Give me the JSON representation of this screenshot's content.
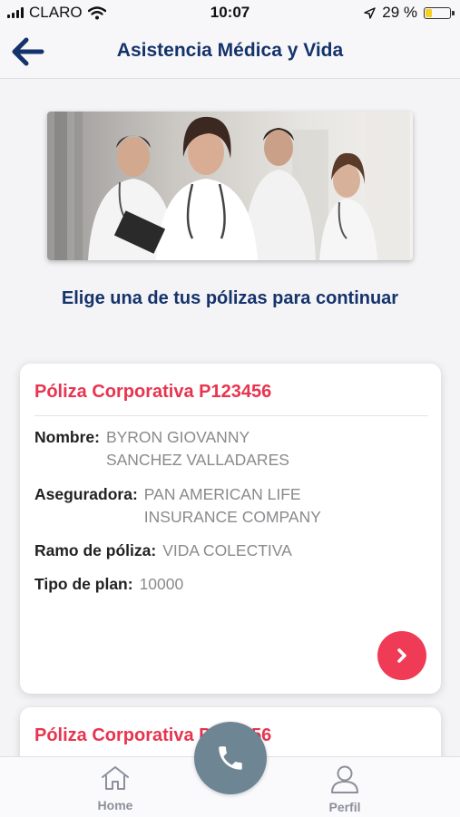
{
  "status_bar": {
    "carrier": "CLARO",
    "time": "10:07",
    "battery_percent": "29 %",
    "battery_level": 0.29
  },
  "header": {
    "title": "Asistencia Médica y Vida",
    "back_icon": "arrow-left-icon"
  },
  "main": {
    "subtitle": "Elige una de tus pólizas para continuar"
  },
  "policies": [
    {
      "title": "Póliza Corporativa P123456",
      "fields": [
        {
          "label": "Nombre:",
          "value_lines": [
            "BYRON GIOVANNY",
            "SANCHEZ VALLADARES"
          ]
        },
        {
          "label": "Aseguradora:",
          "value_lines": [
            "PAN AMERICAN LIFE",
            "INSURANCE COMPANY"
          ]
        },
        {
          "label": "Ramo de póliza:",
          "value": "VIDA COLECTIVA"
        },
        {
          "label": "Tipo de plan:",
          "value": "10000"
        }
      ]
    },
    {
      "title": "Póliza Corporativa P123456"
    }
  ],
  "bottom_nav": {
    "items": [
      {
        "label": "Home",
        "icon": "home-icon"
      },
      {
        "label": "Perfil",
        "icon": "user-icon"
      }
    ],
    "call_icon": "phone-icon"
  },
  "colors": {
    "brand_blue": "#15336b",
    "accent_red": "#e8344f",
    "call_button": "#6e8594",
    "battery": "#f5d020"
  }
}
